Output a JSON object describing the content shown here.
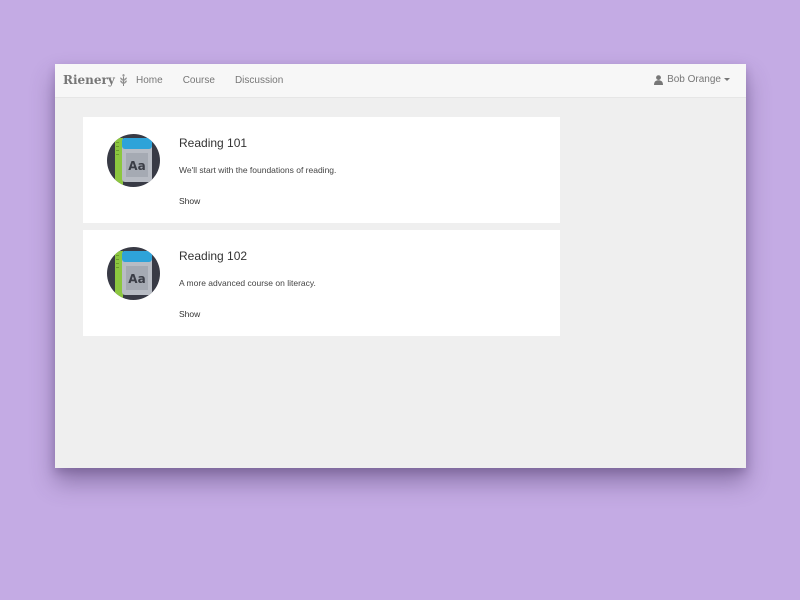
{
  "app": {
    "brand": "Rienery",
    "brand_icon": "sprout-icon"
  },
  "nav": {
    "links": [
      "Home",
      "Course",
      "Discussion"
    ]
  },
  "user": {
    "name": "Bob Orange",
    "icon": "user-icon"
  },
  "courses": [
    {
      "title": "Reading 101",
      "description": "We'll start with the foundations of reading.",
      "action": "Show",
      "icon": "book-icon",
      "icon_text": "Aa"
    },
    {
      "title": "Reading 102",
      "description": "A more advanced course on literacy.",
      "action": "Show",
      "icon": "book-icon",
      "icon_text": "Aa"
    }
  ],
  "colors": {
    "background": "#c4abe4",
    "navbar": "#f7f7f7",
    "content": "#efefef",
    "card": "#ffffff",
    "thumb_bg": "#383a45",
    "book_green": "#8cc63f",
    "book_blue": "#2ea3d9"
  }
}
